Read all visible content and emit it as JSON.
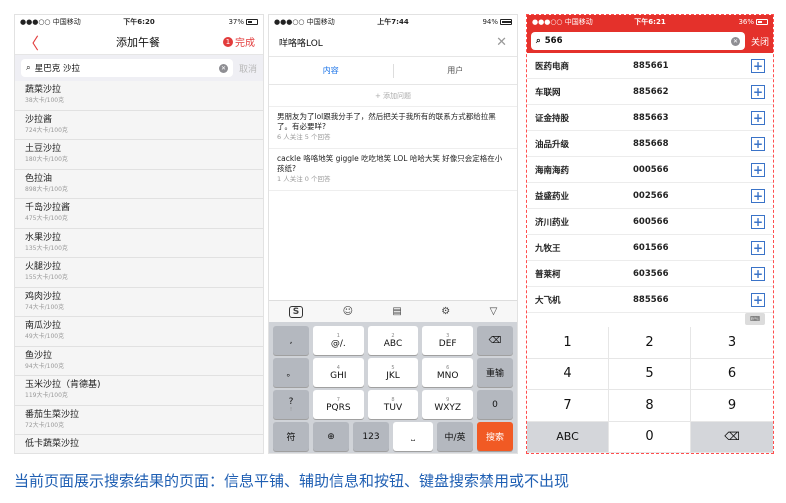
{
  "phone1": {
    "status": {
      "carrier": "●●●○○ 中国移动 ",
      "time": "下午6:20",
      "right": "37%"
    },
    "nav": {
      "back": "〈",
      "title": "添加午餐",
      "badge": "1",
      "done": "完成"
    },
    "search": {
      "value": "星巴克 沙拉",
      "cancel": "取消"
    },
    "foods": [
      {
        "name": "蔬菜沙拉",
        "cal": "38大卡/100克"
      },
      {
        "name": "沙拉酱",
        "cal": "724大卡/100克"
      },
      {
        "name": "土豆沙拉",
        "cal": "180大卡/100克"
      },
      {
        "name": "色拉油",
        "cal": "898大卡/100克"
      },
      {
        "name": "千岛沙拉酱",
        "cal": "475大卡/100克"
      },
      {
        "name": "水果沙拉",
        "cal": "135大卡/100克"
      },
      {
        "name": "火腿沙拉",
        "cal": "155大卡/100克"
      },
      {
        "name": "鸡肉沙拉",
        "cal": "74大卡/100克"
      },
      {
        "name": "南瓜沙拉",
        "cal": "49大卡/100克"
      },
      {
        "name": "鱼沙拉",
        "cal": "94大卡/100克"
      },
      {
        "name": "玉米沙拉（肯德基)",
        "cal": "119大卡/100克"
      },
      {
        "name": "番茄生菜沙拉",
        "cal": "72大卡/100克"
      },
      {
        "name": "低卡蔬菜沙拉",
        "cal": ""
      }
    ]
  },
  "phone2": {
    "status": {
      "carrier": "●●●○○ 中国移动 ",
      "time": "上午7:44",
      "right": "94%"
    },
    "search": {
      "value": "咩咯咯LOL",
      "clear": "✕"
    },
    "tabs": {
      "content": "内容",
      "users": "用户"
    },
    "add_question": "+ 添加问题",
    "results": [
      {
        "q": "男朋友为了lol跟我分手了，然后把关于我所有的联系方式都给拉黑了。有必要咩?",
        "meta": "6 人关注  5 个回答"
      },
      {
        "q": "cackle 咯咯地笑 giggle 吃吃地笑 LOL   哈哈大笑 好像只会定格在小孩纸?",
        "meta": "1 人关注  0 个回答"
      }
    ],
    "keyboard": {
      "row1": [
        {
          "sm": "",
          "l": ","
        },
        {
          "sm": "1",
          "l": "@/."
        },
        {
          "sm": "2",
          "l": "ABC"
        },
        {
          "sm": "3",
          "l": "DEF"
        },
        {
          "sm": "",
          "l": "⌫"
        }
      ],
      "row2": [
        {
          "sm": "",
          "l": "。"
        },
        {
          "sm": "4",
          "l": "GHI"
        },
        {
          "sm": "5",
          "l": "JKL"
        },
        {
          "sm": "6",
          "l": "MNO"
        },
        {
          "sm": "",
          "l": "重输"
        }
      ],
      "row3": [
        {
          "sm": "",
          "l": "?"
        },
        {
          "sm": "7",
          "l": "PQRS"
        },
        {
          "sm": "8",
          "l": "TUV"
        },
        {
          "sm": "9",
          "l": "WXYZ"
        },
        {
          "sm": "",
          "l": "0"
        }
      ],
      "row4_left": "符",
      "row4_globe": "⊕",
      "row4_num": "123",
      "row4_space": "⎵",
      "row4_lang": "中/英",
      "row4_search": "搜索",
      "row3_left_extra": "!"
    }
  },
  "phone3": {
    "status": {
      "carrier": "●●●○○ 中国移动 ",
      "time": "下午6:21",
      "right": "36%"
    },
    "search": {
      "value": "566",
      "close": "关闭"
    },
    "stocks": [
      {
        "name": "医药电商",
        "code": "885661"
      },
      {
        "name": "车联网",
        "code": "885662"
      },
      {
        "name": "证金持股",
        "code": "885663"
      },
      {
        "name": "油品升级",
        "code": "885668"
      },
      {
        "name": "海南海药",
        "code": "000566"
      },
      {
        "name": "益盛药业",
        "code": "002566"
      },
      {
        "name": "济川药业",
        "code": "600566"
      },
      {
        "name": "九牧王",
        "code": "601566"
      },
      {
        "name": "普莱柯",
        "code": "603566"
      },
      {
        "name": "大飞机",
        "code": "885566"
      }
    ],
    "keys": [
      "1",
      "2",
      "3",
      "4",
      "5",
      "6",
      "7",
      "8",
      "9",
      "ABC",
      "0",
      "⌫"
    ]
  },
  "caption": "当前页面展示搜索结果的页面：信息平铺、辅助信息和按钮、键盘搜索禁用或不出现"
}
